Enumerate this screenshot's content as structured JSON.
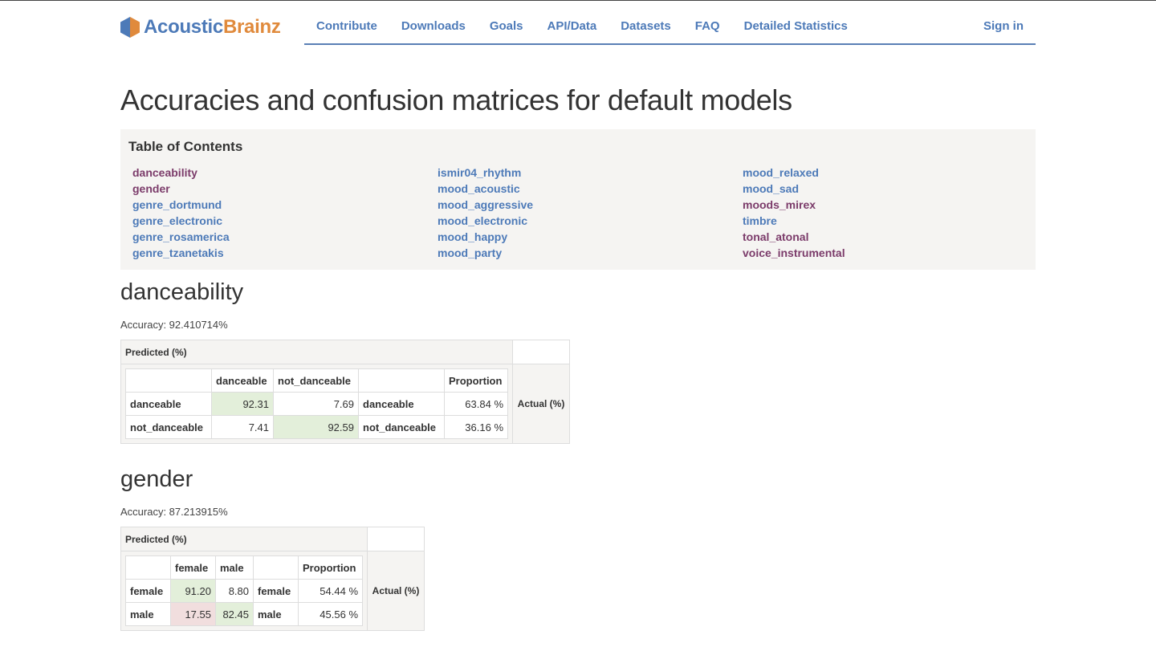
{
  "brand": {
    "part1": "Acoustic",
    "part2": "Brainz"
  },
  "nav": {
    "links": [
      "Contribute",
      "Downloads",
      "Goals",
      "API/Data",
      "Datasets",
      "FAQ",
      "Detailed Statistics"
    ],
    "signin": "Sign in"
  },
  "page_title": "Accuracies and confusion matrices for default models",
  "toc": {
    "title": "Table of Contents",
    "col1": [
      "danceability",
      "gender",
      "genre_dortmund",
      "genre_electronic",
      "genre_rosamerica",
      "genre_tzanetakis"
    ],
    "col2": [
      "ismir04_rhythm",
      "mood_acoustic",
      "mood_aggressive",
      "mood_electronic",
      "mood_happy",
      "mood_party"
    ],
    "col3": [
      "mood_relaxed",
      "mood_sad",
      "moods_mirex",
      "timbre",
      "tonal_atonal",
      "voice_instrumental"
    ]
  },
  "labels": {
    "predicted": "Predicted (%)",
    "actual": "Actual (%)",
    "proportion": "Proportion"
  },
  "danceability": {
    "title": "danceability",
    "accuracy": "Accuracy: 92.410714%",
    "classes": [
      "danceable",
      "not_danceable"
    ],
    "rows": [
      {
        "label": "danceable",
        "v": [
          "92.31",
          "7.69"
        ],
        "prop": "63.84 %"
      },
      {
        "label": "not_danceable",
        "v": [
          "7.41",
          "92.59"
        ],
        "prop": "36.16 %"
      }
    ]
  },
  "gender": {
    "title": "gender",
    "accuracy": "Accuracy: 87.213915%",
    "classes": [
      "female",
      "male"
    ],
    "rows": [
      {
        "label": "female",
        "v": [
          "91.20",
          "8.80"
        ],
        "prop": "54.44 %"
      },
      {
        "label": "male",
        "v": [
          "17.55",
          "82.45"
        ],
        "prop": "45.56 %"
      }
    ]
  },
  "colors": {
    "link": "#4d7ab8",
    "visited": "#7b3b6a",
    "brand_orange": "#e08a3c",
    "cell_green": "#e3efda",
    "cell_red": "#f1dede"
  }
}
